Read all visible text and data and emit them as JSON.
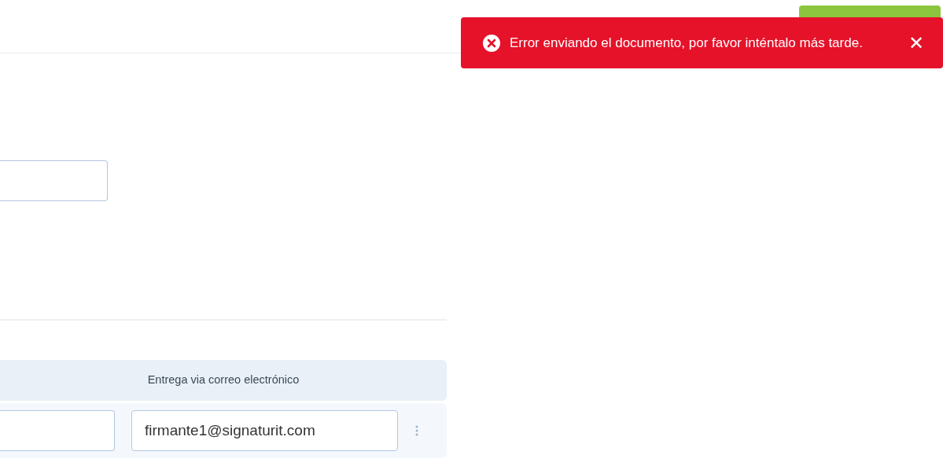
{
  "toast": {
    "kind": "error",
    "message": "Error enviando el documento, por favor inténtalo más tarde.",
    "close": "✕"
  },
  "recipients": {
    "columns": [
      {
        "label": "Entrega via correo electrónico"
      }
    ],
    "rows": [
      {
        "name": "",
        "email": "firmante1@signaturit.com"
      }
    ]
  }
}
